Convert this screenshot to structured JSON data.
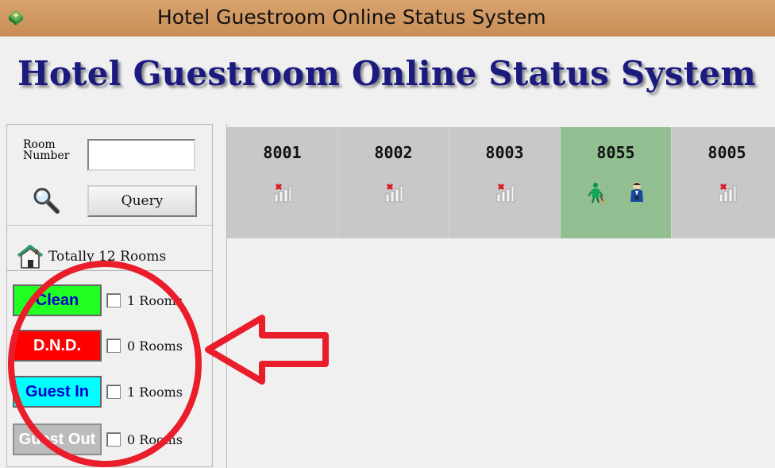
{
  "window": {
    "title": "Hotel Guestroom Online Status System",
    "icon": "app-icon"
  },
  "header": {
    "title": "Hotel Guestroom Online Status System"
  },
  "query": {
    "label": "Room\nNumber",
    "input_value": "",
    "button_label": "Query",
    "search_icon": "search-icon"
  },
  "summary": {
    "text": "Totally 12 Rooms",
    "icon": "house-icon"
  },
  "status_filters": [
    {
      "label": "Clean",
      "count_text": "1 Rooms",
      "checked": false,
      "background": "#22ff22",
      "text_color": "#0000c8",
      "border": "#666666"
    },
    {
      "label": "D.N.D.",
      "count_text": "0 Rooms",
      "checked": false,
      "background": "#ff0000",
      "text_color": "#ffffff",
      "border": "#666666"
    },
    {
      "label": "Guest In",
      "count_text": "1 Rooms",
      "checked": false,
      "background": "#00ffff",
      "text_color": "#0000d0",
      "border": "#666666"
    },
    {
      "label": "Guest Out",
      "count_text": "0 Rooms",
      "checked": false,
      "background": "#bcbcbc",
      "text_color": "#ffffff",
      "border": "#8f8f8f"
    }
  ],
  "rooms": [
    {
      "number": "8001",
      "background": "#c8c8c8",
      "icons": [
        "signal-error-icon"
      ]
    },
    {
      "number": "8002",
      "background": "#c8c8c8",
      "icons": [
        "signal-error-icon"
      ]
    },
    {
      "number": "8003",
      "background": "#c8c8c8",
      "icons": [
        "signal-error-icon"
      ]
    },
    {
      "number": "8055",
      "background": "#91bf92",
      "icons": [
        "cleaner-icon",
        "guest-icon"
      ]
    },
    {
      "number": "8005",
      "background": "#c8c8c8",
      "icons": [
        "signal-error-icon"
      ]
    }
  ],
  "annotation": {
    "color": "#ea1d2b"
  }
}
